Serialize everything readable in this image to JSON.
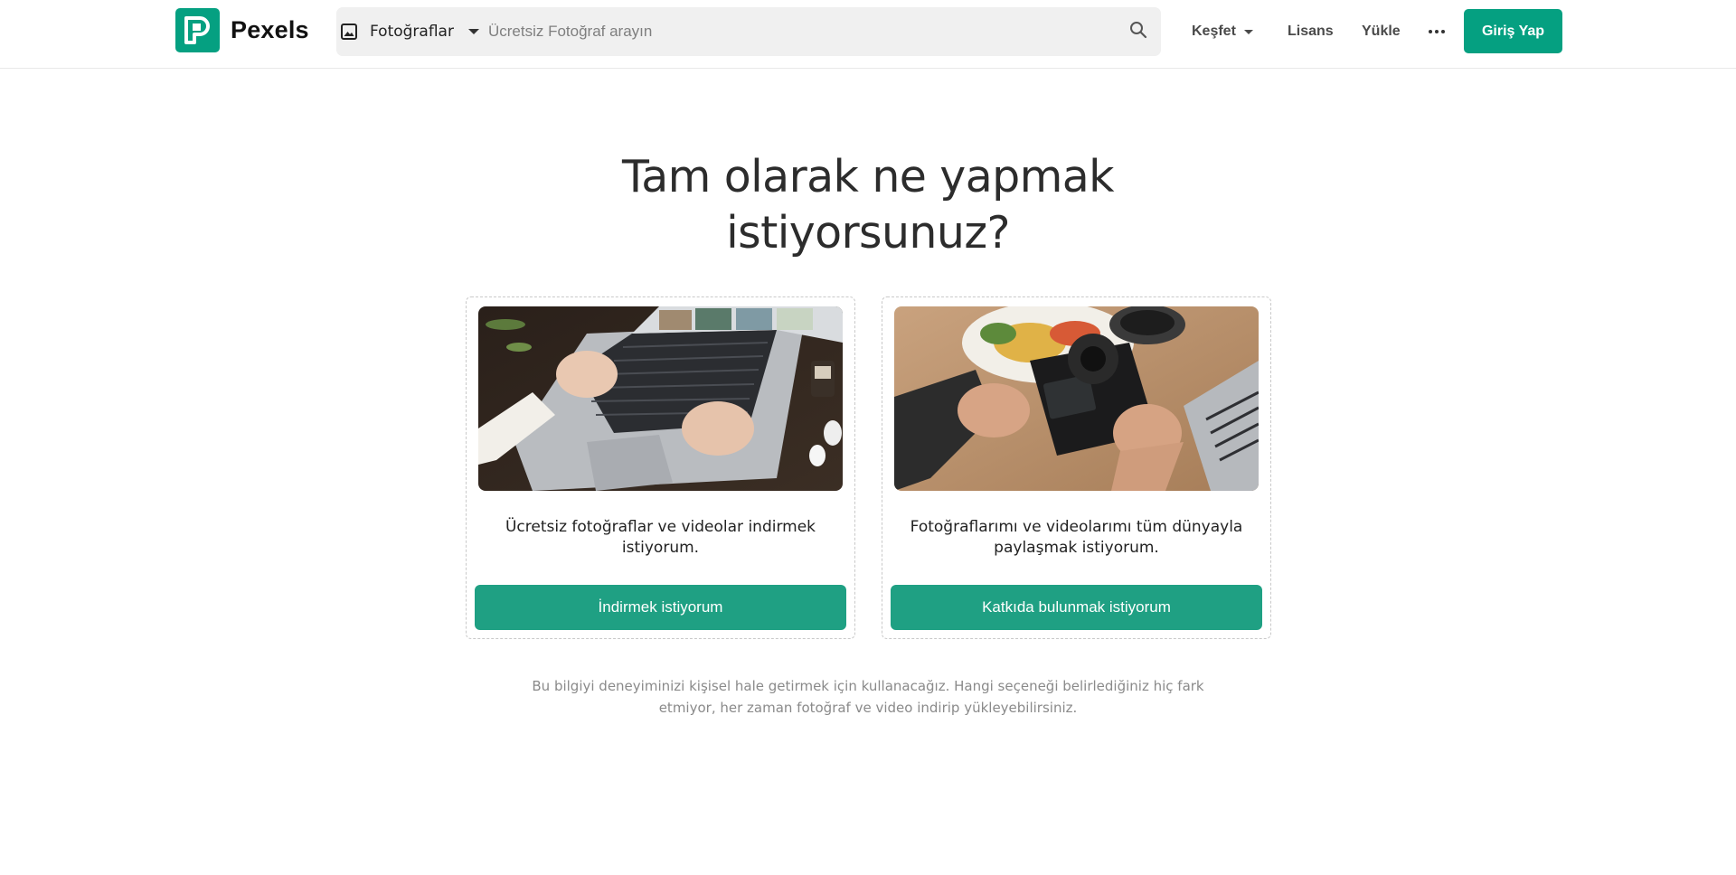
{
  "header": {
    "logo_text": "Pexels",
    "logo_icon": "pexels-logo-icon",
    "search": {
      "type_label": "Fotoğraflar",
      "type_icon": "image-icon",
      "placeholder": "Ücretsiz Fotoğraf arayın",
      "value": "",
      "search_icon": "search-icon"
    },
    "nav": {
      "explore_label": "Keşfet",
      "license_label": "Lisans",
      "upload_label": "Yükle",
      "more_icon": "more-dots-icon",
      "login_label": "Giriş Yap"
    }
  },
  "main": {
    "headline_line1": "Tam olarak ne yapmak",
    "headline_line2": "istiyorsunuz?",
    "cards": [
      {
        "description": "Ücretsiz fotoğraflar ve videolar indirmek istiyorum.",
        "button_label": "İndirmek istiyorum"
      },
      {
        "description": "Fotoğraflarımı ve videolarımı tüm dünyayla paylaşmak istiyorum.",
        "button_label": "Katkıda bulunmak istiyorum"
      }
    ],
    "footnote": "Bu bilgiyi deneyiminizi kişisel hale getirmek için kullanacağız. Hangi seçeneği belirlediğiniz hiç fark etmiyor, her zaman fotoğraf ve video indirip yükleyebilirsiniz."
  },
  "colors": {
    "brand": "#05a081",
    "button": "#1fa083",
    "headline": "#2c2c2c",
    "muted": "#8a8a8a"
  }
}
